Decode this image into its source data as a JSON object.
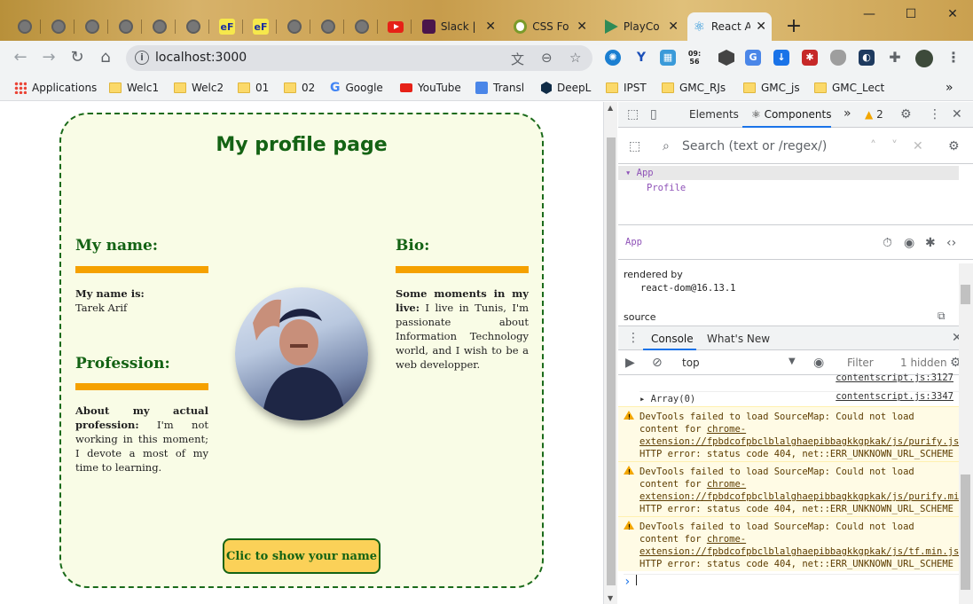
{
  "browser": {
    "tabs": [
      {
        "icon": "globe-icon"
      },
      {
        "icon": "globe-icon"
      },
      {
        "icon": "globe-icon"
      },
      {
        "icon": "globe-icon"
      },
      {
        "icon": "globe-icon"
      },
      {
        "icon": "ef-icon",
        "text": "eF"
      },
      {
        "icon": "ef-icon",
        "text": "eF"
      },
      {
        "icon": "globe-icon"
      },
      {
        "icon": "globe-icon"
      },
      {
        "icon": "globe-icon"
      },
      {
        "icon": "youtube-icon"
      }
    ],
    "wide_tabs": [
      {
        "label": "Slack |",
        "icon": "slack-icon"
      },
      {
        "label": "CSS Fo",
        "icon": "css-icon"
      },
      {
        "label": "PlayCo",
        "icon": "playcode-icon"
      },
      {
        "label": "React A",
        "icon": "react-icon",
        "active": true
      }
    ],
    "new_tab": "+",
    "window_controls": {
      "minimize": "—",
      "maximize": "☐",
      "close": "✕"
    },
    "url": "localhost:3000",
    "ext_clock": "09:\n56",
    "bookmarks": [
      {
        "label": "Applications",
        "icon": "apps-icon"
      },
      {
        "label": "Welc1",
        "icon": "folder-icon"
      },
      {
        "label": "Welc2",
        "icon": "folder-icon"
      },
      {
        "label": "01",
        "icon": "folder-icon"
      },
      {
        "label": "02",
        "icon": "folder-icon"
      },
      {
        "label": "Google",
        "icon": "google-icon"
      },
      {
        "label": "YouTube",
        "icon": "youtube-icon"
      },
      {
        "label": "Transl",
        "icon": "translate-icon"
      },
      {
        "label": "DeepL",
        "icon": "deepl-icon"
      },
      {
        "label": "IPST",
        "icon": "folder-icon"
      },
      {
        "label": "GMC_RJs",
        "icon": "folder-icon"
      },
      {
        "label": "GMC_js",
        "icon": "folder-icon"
      },
      {
        "label": "GMC_Lect",
        "icon": "folder-icon"
      }
    ],
    "bookmarks_more": "»"
  },
  "page": {
    "title": "My profile page",
    "name_section": {
      "title": "My name:",
      "label": "My name is:",
      "value": "Tarek Arif"
    },
    "profession_section": {
      "title": "Profession:",
      "label": "About my actual profession:",
      "value": " I'm not working in this moment; I devote a most of my time to learning."
    },
    "bio_section": {
      "title": "Bio:",
      "label": "Some moments in my live:",
      "value": " I live in Tunis, I'm passionate about Information Technology world, and I wish to be a web developper."
    },
    "button_label": "Clic to show your name",
    "accent_color": "#146314",
    "bar_color": "#f5a100"
  },
  "devtools": {
    "tabs": {
      "elements": "Elements",
      "components": "⚛ Components",
      "more": "»"
    },
    "warnings_count": "2",
    "search_placeholder": "Search (text or /regex/)",
    "tree": {
      "root": "▾ App",
      "child": "Profile"
    },
    "selected": "App",
    "rendered_by_label": "rendered by",
    "rendered_by_value": "react-dom@16.13.1",
    "source_label": "source",
    "console_tabs": {
      "console": "Console",
      "whats_new": "What's New"
    },
    "context": "top",
    "filter_placeholder": "Filter",
    "hidden": "1 hidden",
    "logs": {
      "link1": "contentscript.js:3127",
      "array": "▸ Array(0)",
      "link2": "contentscript.js:3347"
    },
    "warnings": [
      {
        "pre": "DevTools failed to load SourceMap: Could not load content for ",
        "link": "chrome-extension://fpbdcofpbclblalghaepibbagkkgpkak/js/purify.js.map",
        "post": ": HTTP error: status code 404, net::ERR_UNKNOWN_URL_SCHEME"
      },
      {
        "pre": "DevTools failed to load SourceMap: Could not load content for ",
        "link": "chrome-extension://fpbdcofpbclblalghaepibbagkkgpkak/js/purify.min.js.map",
        "post": ": HTTP error: status code 404, net::ERR_UNKNOWN_URL_SCHEME"
      },
      {
        "pre": "DevTools failed to load SourceMap: Could not load content for ",
        "link": "chrome-extension://fpbdcofpbclblalghaepibbagkkgpkak/js/tf.min.js.map",
        "post": ": HTTP error: status code 404, net::ERR_UNKNOWN_URL_SCHEME"
      }
    ],
    "prompt": "›"
  }
}
